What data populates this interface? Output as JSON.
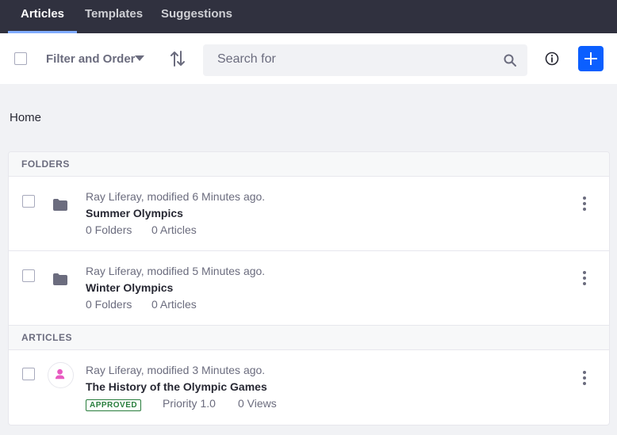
{
  "nav": {
    "tabs": [
      {
        "label": "Articles",
        "active": true
      },
      {
        "label": "Templates",
        "active": false
      },
      {
        "label": "Suggestions",
        "active": false
      }
    ]
  },
  "toolbar": {
    "filter_label": "Filter and Order",
    "search_placeholder": "Search for"
  },
  "breadcrumb": "Home",
  "folders_header": "FOLDERS",
  "folders": [
    {
      "meta": "Ray Liferay, modified 6 Minutes ago.",
      "title": "Summer Olympics",
      "folders": "0 Folders",
      "articles": "0 Articles"
    },
    {
      "meta": "Ray Liferay, modified 5 Minutes ago.",
      "title": "Winter Olympics",
      "folders": "0 Folders",
      "articles": "0 Articles"
    }
  ],
  "articles_header": "ARTICLES",
  "articles": [
    {
      "meta": "Ray Liferay, modified 3 Minutes ago.",
      "title": "The History of the Olympic Games",
      "status": "APPROVED",
      "priority": "Priority 1.0",
      "views": "0 Views"
    }
  ],
  "colors": {
    "nav_bg": "#30313f",
    "accent": "#0b5fff",
    "approved": "#287d3c",
    "avatar": "#e85ac1"
  }
}
